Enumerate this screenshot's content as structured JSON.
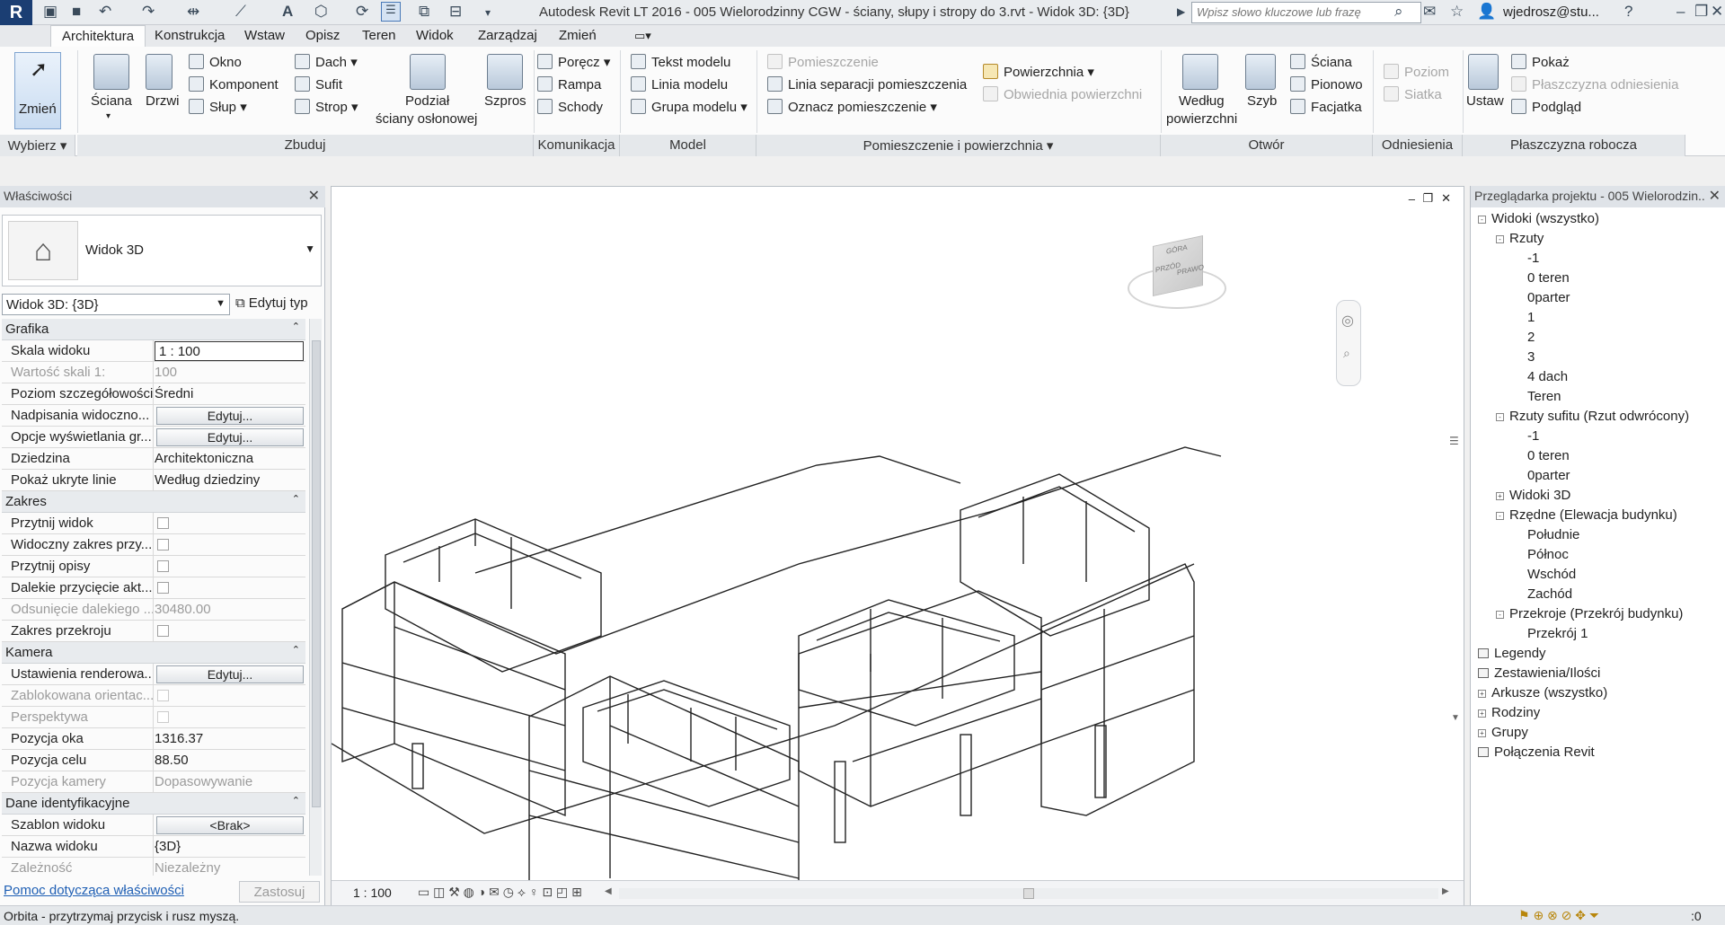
{
  "window": {
    "title": "Autodesk Revit LT 2016 -     005 Wielorodzinny CGW - ściany, słupy i stropy do 3.rvt - Widok 3D: {3D}",
    "search_placeholder": "Wpisz słowo kluczowe lub frazę",
    "user": "wjedrosz@stu..."
  },
  "tabs": [
    "Architektura",
    "Konstrukcja",
    "Wstaw",
    "Opisz",
    "Teren",
    "Widok",
    "Zarządzaj",
    "Zmień"
  ],
  "ribbon": {
    "modify": "Zmień",
    "select_panel": "Wybierz",
    "build": {
      "wall": "Ściana",
      "door": "Drzwi",
      "window": "Okno",
      "component": "Komponent",
      "column": "Słup",
      "roof": "Dach",
      "ceiling": "Sufit",
      "floor": "Strop",
      "curtain_grid_line1": "Podział",
      "curtain_grid_line2": "ściany osłonowej",
      "mullion": "Szpros",
      "panel": "Zbuduj"
    },
    "circulation": {
      "railing": "Poręcz",
      "ramp": "Rampa",
      "stair": "Schody",
      "panel": "Komunikacja"
    },
    "model": {
      "text": "Tekst modelu",
      "line": "Linia modelu",
      "group": "Grupa modelu",
      "panel": "Model"
    },
    "room": {
      "room": "Pomieszczenie",
      "separator": "Linia separacji  pomieszczenia",
      "tag": "Oznacz  pomieszczenie",
      "area": "Powierzchnia",
      "area_boundary": "Obwiednia  powierzchni",
      "panel": "Pomieszczenie i powierzchnia"
    },
    "opening": {
      "by_face_line1": "Według",
      "by_face_line2": "powierzchni",
      "shaft": "Szyb",
      "wall": "Ściana",
      "vertical": "Pionowo",
      "dormer": "Facjatka",
      "panel": "Otwór"
    },
    "datum": {
      "level": "Poziom",
      "grid": "Siatka",
      "panel": "Odniesienia"
    },
    "workplane": {
      "set": "Ustaw",
      "show": "Pokaż",
      "ref_plane": "Płaszczyzna odniesienia",
      "viewer": "Podgląd",
      "panel": "Płaszczyzna robocza"
    }
  },
  "properties": {
    "title": "Właściwości",
    "type_name": "Widok 3D",
    "selector": "Widok 3D: {3D}",
    "edit_type": "Edytuj typ",
    "groups": {
      "graphics": "Grafika",
      "extents": "Zakres",
      "camera": "Kamera",
      "identity": "Dane identyfikacyjne"
    },
    "rows": {
      "scale_label": "Skala widoku",
      "scale_value": "1 : 100",
      "scale_val_label": "Wartość skali   1:",
      "scale_val_value": "100",
      "detail_label": "Poziom szczegółowości",
      "detail_value": "Średni",
      "vg_label": "Nadpisania widoczno...",
      "vg_btn": "Edytuj...",
      "gd_label": "Opcje wyświetlania gr...",
      "gd_btn": "Edytuj...",
      "discipline_label": "Dziedzina",
      "discipline_value": "Architektoniczna",
      "hidden_label": "Pokaż ukryte linie",
      "hidden_value": "Według dziedziny",
      "crop_label": "Przytnij widok",
      "crop_vis_label": "Widoczny zakres przy...",
      "annot_label": "Przytnij opisy",
      "far_label": "Dalekie przycięcie akt...",
      "far_off_label": "Odsunięcie dalekiego ...",
      "far_off_value": "30480.00",
      "section_label": "Zakres przekroju",
      "render_label": "Ustawienia renderowa...",
      "render_btn": "Edytuj...",
      "locked_label": "Zablokowana orientac...",
      "persp_label": "Perspektywa",
      "eye_label": "Pozycja oka",
      "eye_value": "1316.37",
      "target_label": "Pozycja celu",
      "target_value": "88.50",
      "campos_label": "Pozycja kamery",
      "campos_value": "Dopasowywanie",
      "template_label": "Szablon widoku",
      "template_btn": "<Brak>",
      "name_label": "Nazwa widoku",
      "name_value": "{3D}",
      "dep_label": "Zależność",
      "dep_value": "Niezależny"
    },
    "help_link": "Pomoc dotycząca właściwości",
    "apply": "Zastosuj"
  },
  "viewcube": {
    "top": "GÓRA",
    "front": "PRZÓD",
    "right": "PRAWO"
  },
  "view_control": {
    "scale": "1 : 100"
  },
  "browser": {
    "title": "Przeglądarka projektu - 005 Wielorodzin...",
    "items": [
      {
        "label": "Widoki (wszystko)",
        "level": 0,
        "toggle": "-"
      },
      {
        "label": "Rzuty",
        "level": 1,
        "toggle": "-"
      },
      {
        "label": "-1",
        "level": 2
      },
      {
        "label": "0 teren",
        "level": 2
      },
      {
        "label": "0parter",
        "level": 2
      },
      {
        "label": "1",
        "level": 2
      },
      {
        "label": "2",
        "level": 2
      },
      {
        "label": "3",
        "level": 2
      },
      {
        "label": "4 dach",
        "level": 2
      },
      {
        "label": "Teren",
        "level": 2
      },
      {
        "label": "Rzuty sufitu (Rzut odwrócony)",
        "level": 1,
        "toggle": "-"
      },
      {
        "label": "-1",
        "level": 2
      },
      {
        "label": "0 teren",
        "level": 2
      },
      {
        "label": "0parter",
        "level": 2
      },
      {
        "label": "Widoki 3D",
        "level": 1,
        "toggle": "+"
      },
      {
        "label": "Rzędne (Elewacja budynku)",
        "level": 1,
        "toggle": "-"
      },
      {
        "label": "Południe",
        "level": 2
      },
      {
        "label": "Północ",
        "level": 2
      },
      {
        "label": "Wschód",
        "level": 2
      },
      {
        "label": "Zachód",
        "level": 2
      },
      {
        "label": "Przekroje (Przekrój budynku)",
        "level": 1,
        "toggle": "-"
      },
      {
        "label": "Przekrój 1",
        "level": 2
      },
      {
        "label": "Legendy",
        "level": 0
      },
      {
        "label": "Zestawienia/Ilości",
        "level": 0
      },
      {
        "label": "Arkusze (wszystko)",
        "level": 0,
        "toggle": "+"
      },
      {
        "label": "Rodziny",
        "level": 0,
        "toggle": "+"
      },
      {
        "label": "Grupy",
        "level": 0,
        "toggle": "+"
      },
      {
        "label": "Połączenia Revit",
        "level": 0
      }
    ]
  },
  "status": {
    "text": "Orbita - przytrzymaj przycisk i rusz myszą.",
    "filter_count": ":0"
  },
  "colors": {
    "accent": "#2f6db5",
    "link": "#1f5fb4",
    "app_bg": "#f0f0f0"
  }
}
